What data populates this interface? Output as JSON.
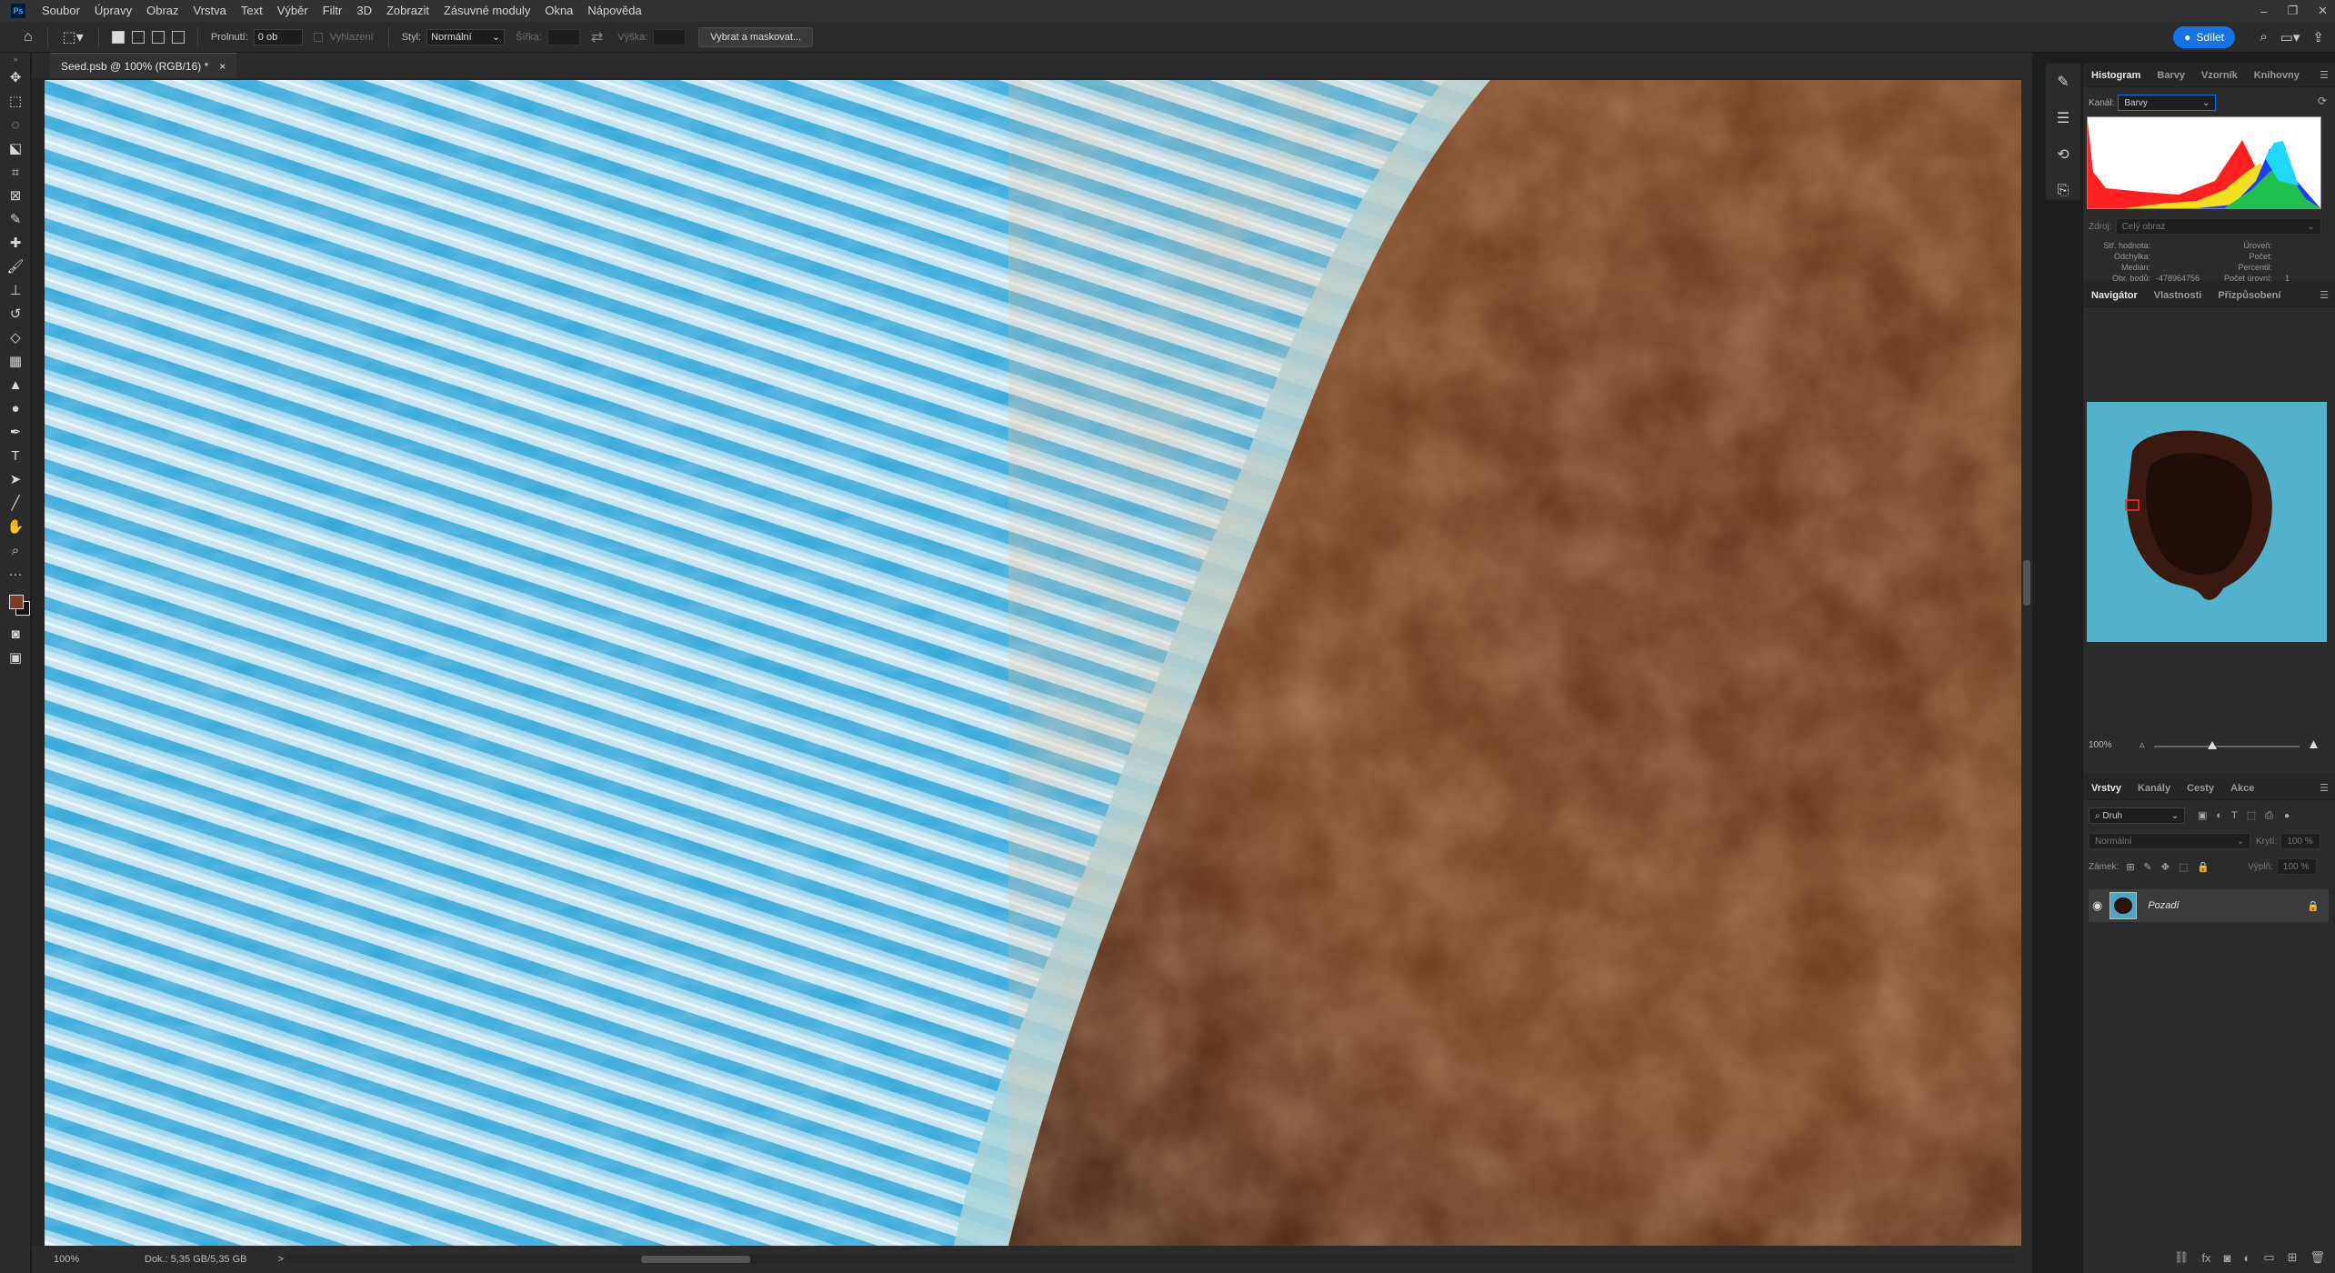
{
  "app": {
    "logo": "Ps"
  },
  "menu": [
    "Soubor",
    "Úpravy",
    "Obraz",
    "Vrstva",
    "Text",
    "Výběr",
    "Filtr",
    "3D",
    "Zobrazit",
    "Zásuvné moduly",
    "Okna",
    "Nápověda"
  ],
  "window_controls": {
    "minimize": "–",
    "restore": "❐",
    "close": "✕"
  },
  "options": {
    "feather_label": "Prolnutí:",
    "feather_value": "0 ob",
    "antialias_label": "Vyhlazení",
    "style_label": "Styl:",
    "style_value": "Normální",
    "width_label": "Šířka:",
    "height_label": "Výška:",
    "mask_button": "Vybrat a maskovat...",
    "share_button": "Sdílet"
  },
  "document": {
    "tab_title": "Seed.psb @ 100% (RGB/16) *",
    "close": "×"
  },
  "status": {
    "zoom": "100%",
    "doc": "Dok.: 5,35 GB/5,35 GB",
    "arrow": ">"
  },
  "histogram": {
    "tabs": [
      "Histogram",
      "Barvy",
      "Vzorník",
      "Knihovny"
    ],
    "channel_label": "Kanál:",
    "channel_value": "Barvy",
    "source_label": "Zdroj:",
    "source_value": "Celý obraz",
    "stats_left_labels": [
      "Stř. hodnota:",
      "Odchylka:",
      "Medián:",
      "Obr. bodů:"
    ],
    "pixels_value": "-478964756",
    "stats_right_labels": [
      "Úroveň:",
      "Počet:",
      "Percentil:",
      "Počet úrovní:"
    ],
    "levels_value": "1"
  },
  "navigator": {
    "tabs": [
      "Navigátor",
      "Vlastnosti",
      "Přizpůsobení"
    ],
    "zoom": "100%",
    "zoom_fraction": 0.4
  },
  "layers": {
    "tabs": [
      "Vrstvy",
      "Kanály",
      "Cesty",
      "Akce"
    ],
    "filter_placeholder": "Druh",
    "blend_mode": "Normální",
    "opacity_label": "Krytí:",
    "opacity_value": "100 %",
    "lock_label": "Zámek:",
    "fill_label": "Výplň:",
    "fill_value": "100 %",
    "items": [
      {
        "name": "Pozadí",
        "visible": true,
        "locked": true
      }
    ]
  },
  "colors": {
    "accent": "#1473e6",
    "foreground": "#7a3c22",
    "background": "#111111"
  }
}
